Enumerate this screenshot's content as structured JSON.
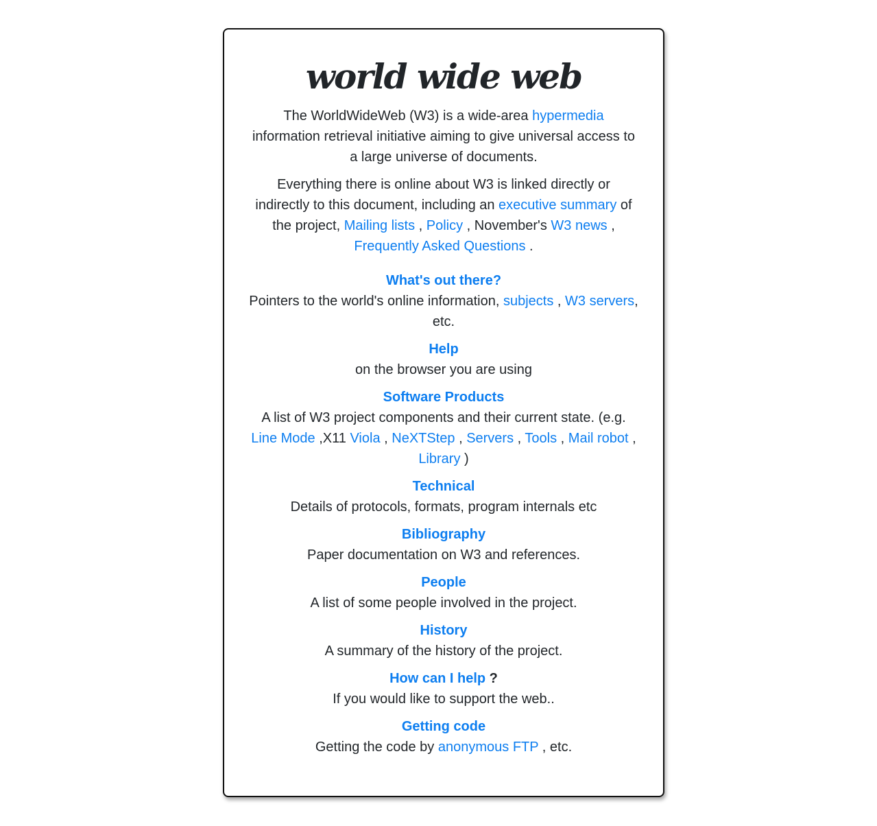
{
  "title": "world wide web",
  "intro": {
    "t1": "The WorldWideWeb (W3) is a wide-area ",
    "link_hypermedia": "hypermedia",
    "t2": " information retrieval initiative aiming to give universal access to a large universe of documents."
  },
  "summary": {
    "t1": "Everything there is online about W3 is linked directly or indirectly to this document, including an ",
    "link_exec": "executive summary",
    "t2": " of the project, ",
    "link_mailing": "Mailing lists",
    "t3": " , ",
    "link_policy": "Policy",
    "t4": " , November's ",
    "link_news": "W3 news",
    "t5": " , ",
    "link_faq": "Frequently Asked Questions",
    "t6": " ."
  },
  "sections": {
    "whats_out": {
      "heading": "What's out there?",
      "t1": "Pointers to the world's online information, ",
      "link_subjects": "subjects",
      "t2": " , ",
      "link_servers": "W3 servers",
      "t3": ", etc."
    },
    "help": {
      "heading": "Help",
      "desc": "on the browser you are using"
    },
    "software": {
      "heading": "Software Products",
      "t1": "A list of W3 project components and their current state. (e.g. ",
      "link_linemode": "Line Mode",
      "t2": " ,X11 ",
      "link_viola": "Viola",
      "t3": " , ",
      "link_nextstep": "NeXTStep",
      "t4": " , ",
      "link_servers": "Servers",
      "t5": " , ",
      "link_tools": "Tools",
      "t6": " , ",
      "link_mailrobot": "Mail robot",
      "t7": " , ",
      "link_library": "Library",
      "t8": " )"
    },
    "technical": {
      "heading": "Technical",
      "desc": "Details of protocols, formats, program internals etc"
    },
    "bibliography": {
      "heading": "Bibliography",
      "desc": "Paper documentation on W3 and references."
    },
    "people": {
      "heading": "People",
      "desc": "A list of some people involved in the project."
    },
    "history": {
      "heading": "History",
      "desc": "A summary of the history of the project."
    },
    "howhelp": {
      "heading": "How can I help",
      "suffix": " ?",
      "desc": "If you would like to support the web.."
    },
    "code": {
      "heading": "Getting code",
      "t1": "Getting the code by ",
      "link_ftp": "anonymous FTP",
      "t2": " , etc."
    }
  },
  "colors": {
    "link": "#0d7ef0",
    "text": "#212529",
    "border": "#111111"
  }
}
